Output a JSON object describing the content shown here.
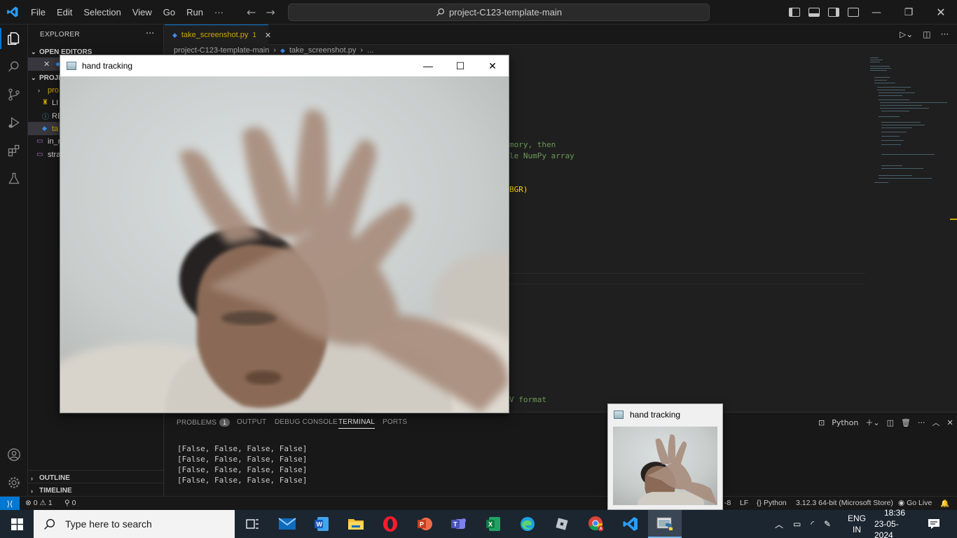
{
  "menu": [
    "File",
    "Edit",
    "Selection",
    "View",
    "Go",
    "Run"
  ],
  "menu_more": "···",
  "search": {
    "text": "project-C123-template-main"
  },
  "sidebar": {
    "title": "EXPLORER",
    "more": "···",
    "open_editors": "OPEN EDITORS",
    "project_section": "PROJE",
    "items": [
      {
        "label": "pro"
      },
      {
        "label": "LI"
      },
      {
        "label": "RE"
      },
      {
        "label": "ta"
      },
      {
        "label": "in_r"
      },
      {
        "label": "stra"
      }
    ],
    "outline": "OUTLINE",
    "timeline": "TIMELINE"
  },
  "editor": {
    "tab_label": "take_screenshot.py",
    "tab_modified": "1",
    "breadcrumb": [
      "project-C123-template-main",
      "take_screenshot.py",
      "..."
    ],
    "code_fragments": {
      "line1": "mory, then",
      "line2": "le NumPy array",
      "line3": "BGR)",
      "line4": "V format"
    }
  },
  "panel": {
    "tabs": [
      "PROBLEMS",
      "OUTPUT",
      "DEBUG CONSOLE",
      "TERMINAL",
      "PORTS"
    ],
    "problems_count": "1",
    "active_tab": "TERMINAL",
    "terminal_profile": "Python",
    "terminal_lines": [
      "[False, False, False, False]",
      "[False, False, False, False]",
      "[False, False, False, False]",
      "[False, False, False, False]"
    ]
  },
  "statusbar": {
    "errors": "0",
    "warnings": "1",
    "ports": "0",
    "encoding_tail": "-8",
    "eol": "LF",
    "language": "Python",
    "interpreter": "3.12.3 64-bit (Microsoft Store)",
    "golive": "Go Live"
  },
  "cv_window": {
    "title": "hand tracking"
  },
  "thumbnail": {
    "title": "hand tracking"
  },
  "taskbar": {
    "search_placeholder": "Type here to search",
    "lang_top": "ENG",
    "lang_bottom": "IN",
    "time": "18:36",
    "date": "23-05-2024"
  },
  "colors": {
    "accent": "#0078d4",
    "editor_bg": "#1f1f1f",
    "chrome_bg": "#181818",
    "comment": "#6a9955",
    "taskbar_bg": "#1c2631"
  }
}
